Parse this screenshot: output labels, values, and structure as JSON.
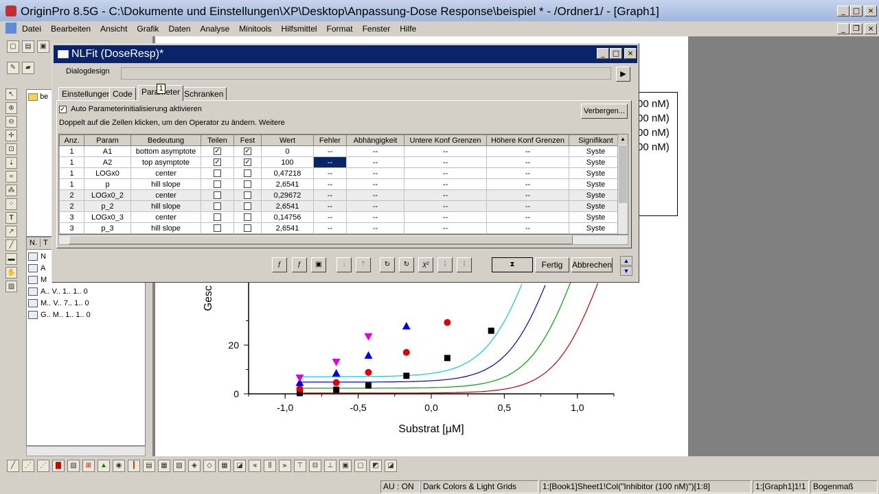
{
  "app": {
    "title": "OriginPro 8.5G - C:\\Dokumente und Einstellungen\\XP\\Desktop\\Anpassung-Dose Response\\beispiel * - /Ordner1/ - [Graph1]"
  },
  "menu": [
    "Datei",
    "Bearbeiten",
    "Ansicht",
    "Grafik",
    "Daten",
    "Analyse",
    "Minitools",
    "Hilfsmittel",
    "Format",
    "Fenster",
    "Hilfe"
  ],
  "project": {
    "folder": "be",
    "columns": [
      "N.",
      "T"
    ],
    "items": [
      {
        "c1": "N",
        "c2": "",
        "c3": "",
        "c4": ""
      },
      {
        "c1": "A",
        "c2": "",
        "c3": "",
        "c4": ""
      },
      {
        "c1": "M",
        "c2": "",
        "c3": "",
        "c4": ""
      },
      {
        "c1": "A..",
        "c2": "V..",
        "c3": "1..",
        "c4": "1..  0"
      },
      {
        "c1": "M..",
        "c2": "V..",
        "c3": "7..",
        "c4": "1..  0"
      },
      {
        "c1": "G..",
        "c2": "M..",
        "c3": "1..",
        "c4": "1..  0"
      }
    ]
  },
  "legend": [
    "00 nM)",
    "00 nM)",
    "00 nM)",
    "00 nM)"
  ],
  "dialog": {
    "title": "NLFit (DoseResp)*",
    "design_label": "Dialogdesign",
    "tabs": [
      "Einstellungen",
      "Code",
      "Parameter",
      "Schranken"
    ],
    "tab_badge": "1",
    "auto_init_label": "Auto Parameterinitialisierung aktivieren",
    "hint": "Doppelt auf die Zellen klicken, um den Operator zu ändern. Weitere",
    "hide_button": "Verbergen...",
    "columns": [
      "Anz.",
      "Param",
      "Bedeutung",
      "Teilen",
      "Fest",
      "Wert",
      "Fehler",
      "Abhängigkeit",
      "Untere Konf Grenzen",
      "Höhere Konf Grenzen",
      "Signifikant"
    ],
    "rows": [
      {
        "n": "1",
        "param": "A1",
        "meaning": "bottom asymptote",
        "share": true,
        "fixed": true,
        "value": "0",
        "err": "--",
        "dep": "--",
        "lo": "--",
        "hi": "--",
        "sig": "Syste"
      },
      {
        "n": "1",
        "param": "A2",
        "meaning": "top asymptote",
        "share": true,
        "fixed": true,
        "value": "100",
        "err": "--",
        "dep": "--",
        "lo": "--",
        "hi": "--",
        "sig": "Syste"
      },
      {
        "n": "1",
        "param": "LOGx0",
        "meaning": "center",
        "share": false,
        "fixed": false,
        "value": "0,47218",
        "err": "--",
        "dep": "--",
        "lo": "--",
        "hi": "--",
        "sig": "Syste"
      },
      {
        "n": "1",
        "param": "p",
        "meaning": "hill slope",
        "share": false,
        "fixed": false,
        "value": "2,6541",
        "err": "--",
        "dep": "--",
        "lo": "--",
        "hi": "--",
        "sig": "Syste"
      },
      {
        "n": "2",
        "param": "LOGx0_2",
        "meaning": "center",
        "share": false,
        "fixed": false,
        "value": "0,29672",
        "err": "--",
        "dep": "--",
        "lo": "--",
        "hi": "--",
        "sig": "Syste"
      },
      {
        "n": "2",
        "param": "p_2",
        "meaning": "hill slope",
        "share": false,
        "fixed": false,
        "value": "2,6541",
        "err": "--",
        "dep": "--",
        "lo": "--",
        "hi": "--",
        "sig": "Syste"
      },
      {
        "n": "3",
        "param": "LOGx0_3",
        "meaning": "center",
        "share": false,
        "fixed": false,
        "value": "0,14756",
        "err": "--",
        "dep": "--",
        "lo": "--",
        "hi": "--",
        "sig": "Syste"
      },
      {
        "n": "3",
        "param": "p_3",
        "meaning": "hill slope",
        "share": false,
        "fixed": false,
        "value": "2,6541",
        "err": "--",
        "dep": "--",
        "lo": "--",
        "hi": "--",
        "sig": "Syste"
      }
    ],
    "buttons": {
      "done": "Fertig",
      "cancel": "Abbrechen"
    }
  },
  "chart_data": {
    "type": "scatter",
    "xlabel": "Substrat [µM]",
    "ylabel": "Gesc",
    "xticks": [
      "-1,0",
      "-0,5",
      "0,0",
      "0,5",
      "1,0"
    ],
    "yticks": [
      "0",
      "20"
    ],
    "xlim": [
      -1.25,
      1.25
    ],
    "ylim": [
      -10,
      40
    ],
    "series": [
      {
        "color": "#000000",
        "marker": "square",
        "x": [
          -0.9,
          -0.65,
          -0.43,
          -0.17,
          0.11,
          0.41
        ],
        "y": [
          0.3,
          1.7,
          3.4,
          7.4,
          14.7,
          25.9
        ],
        "curve_center": 0.47218
      },
      {
        "color": "#e00000",
        "marker": "circle",
        "x": [
          -0.9,
          -0.65,
          -0.43,
          -0.17,
          0.11
        ],
        "y": [
          2,
          4.6,
          8.8,
          17,
          29.3
        ],
        "curve_center": 0.29672
      },
      {
        "color": "#0000e0",
        "marker": "triangle",
        "x": [
          -0.9,
          -0.65,
          -0.43,
          -0.17
        ],
        "y": [
          4.6,
          8.5,
          15.8,
          27.8
        ],
        "curve_center": 0.14756
      },
      {
        "color": "#e000e0",
        "marker": "triangle-down",
        "x": [
          -0.9,
          -0.65,
          -0.43
        ],
        "y": [
          6.5,
          13,
          23.5
        ],
        "curve_center": 0
      }
    ]
  }
}
